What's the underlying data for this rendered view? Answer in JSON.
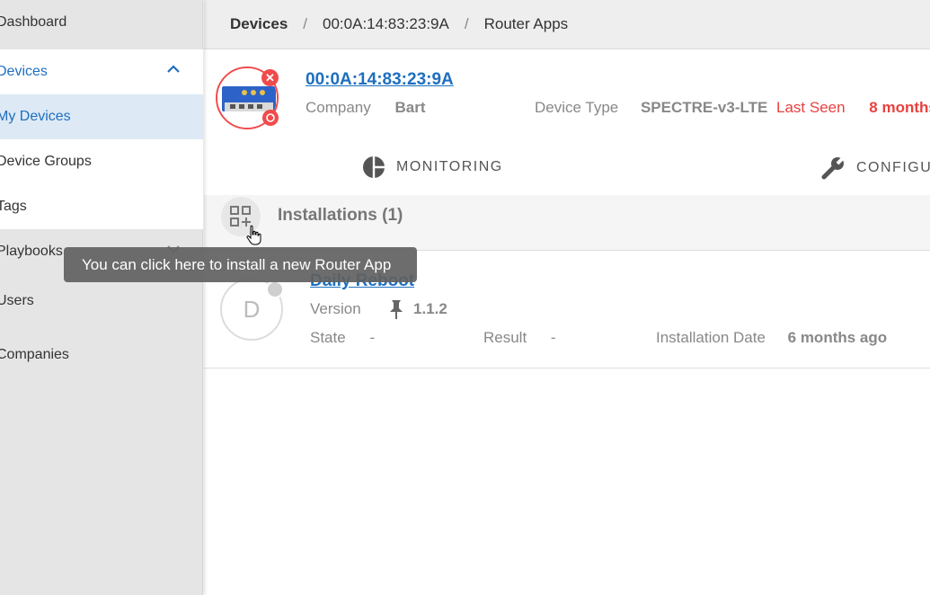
{
  "sidebar": {
    "items": [
      {
        "label": "Dashboard"
      },
      {
        "label": "Devices"
      },
      {
        "label": "My Devices"
      },
      {
        "label": "Device Groups"
      },
      {
        "label": "Tags"
      },
      {
        "label": "Playbooks"
      },
      {
        "label": "Users"
      },
      {
        "label": "Companies"
      }
    ]
  },
  "breadcrumb": {
    "items": [
      "Devices",
      "00:0A:14:83:23:9A",
      "Router Apps"
    ],
    "separator": "/"
  },
  "device": {
    "mac": "00:0A:14:83:23:9A",
    "company_label": "Company",
    "company_value": "Bart",
    "type_label": "Device Type",
    "type_value": "SPECTRE-v3-LTE",
    "last_seen_label": "Last Seen",
    "last_seen_value": "8 months"
  },
  "tabs": [
    {
      "label": "MONITORING",
      "icon": "pie-chart-icon"
    },
    {
      "label": "CONFIGU",
      "icon": "wrench-icon"
    }
  ],
  "installations": {
    "title": "Installations (1)",
    "tooltip": "You can click here to install a new Router App"
  },
  "app": {
    "avatar_letter": "D",
    "name": "Daily Reboot",
    "version_label": "Version",
    "version_value": "1.1.2",
    "state_label": "State",
    "state_value": "-",
    "result_label": "Result",
    "result_value": "-",
    "install_date_label": "Installation Date",
    "install_date_value": "6 months ago"
  },
  "colors": {
    "accent": "#1e6fbf",
    "alert": "#e8413e",
    "sidebar_bg": "#e5e5e5",
    "selected_bg": "#dde9f5"
  }
}
